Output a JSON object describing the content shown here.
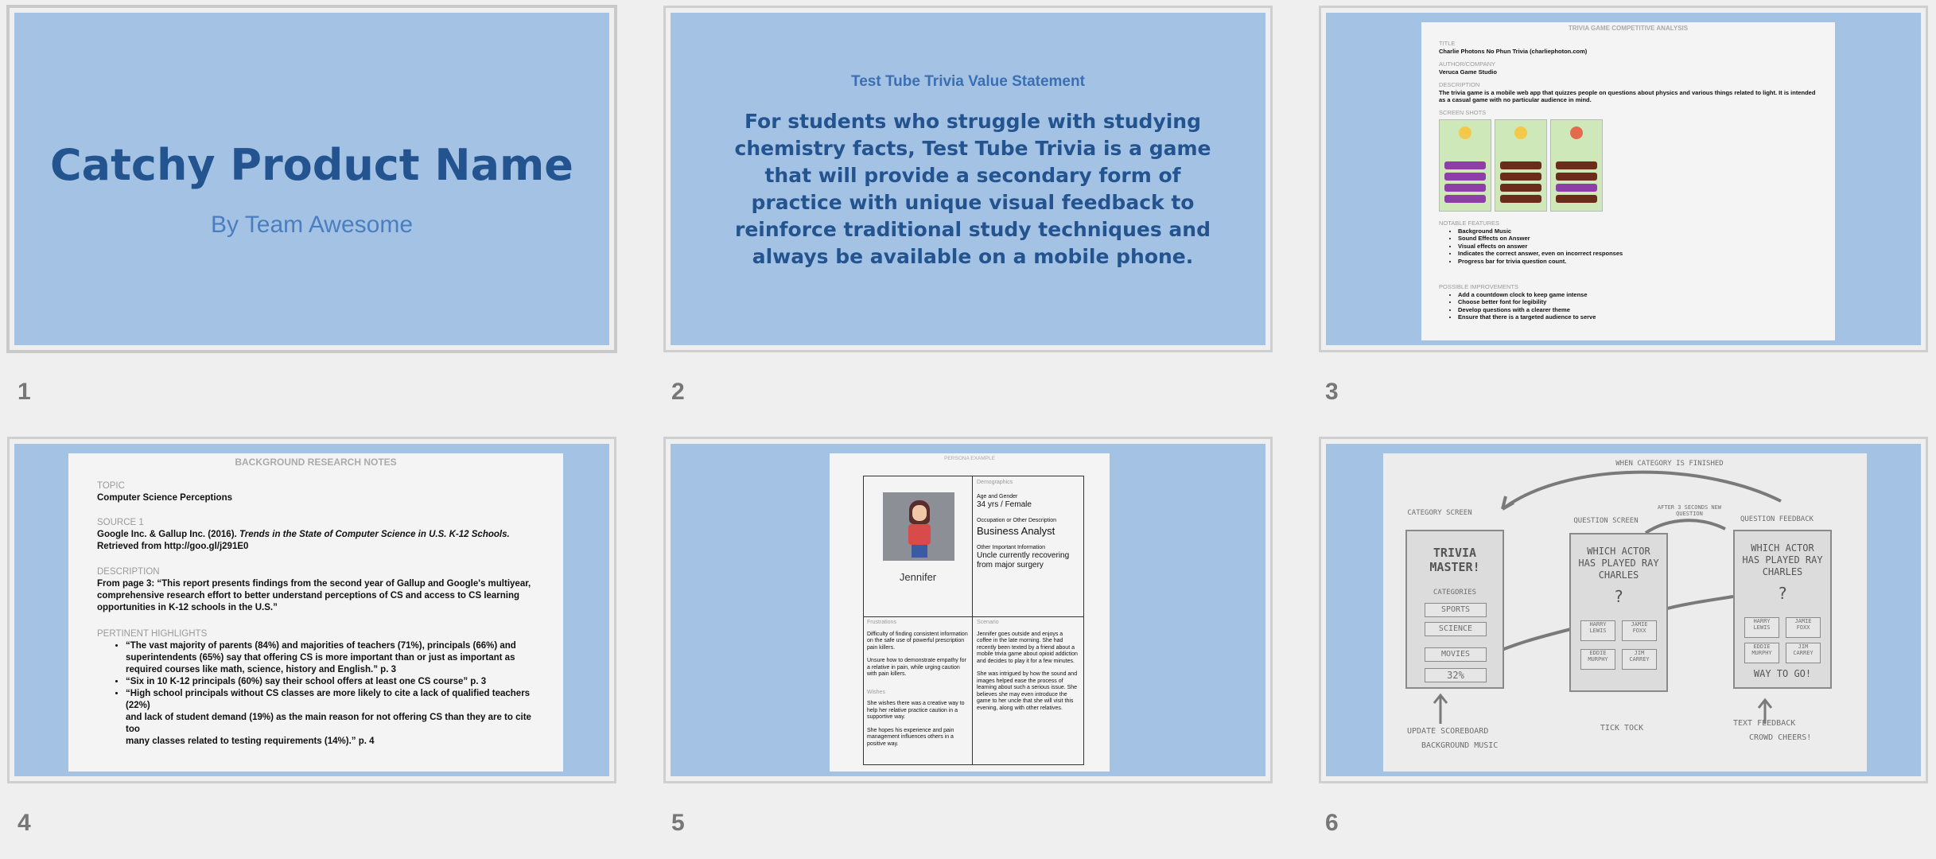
{
  "slides": [
    {
      "number": "1",
      "title": "Catchy Product Name",
      "subtitle": "By Team Awesome"
    },
    {
      "number": "2",
      "title": "Test Tube Trivia Value Statement",
      "body": "For students who struggle with studying chemistry facts, Test Tube Trivia is a game that will provide a secondary form of practice with unique visual feedback to reinforce traditional study techniques and always be available on a mobile phone."
    },
    {
      "number": "3",
      "doc_title": "TRIVIA GAME COMPETITIVE ANALYSIS",
      "title_label": "TITLE",
      "title_value": "Charlie Photons No Phun Trivia (charliephoton.com)",
      "author_label": "AUTHOR/COMPANY",
      "author_value": "Veruca Game Studio",
      "desc_label": "DESCRIPTION",
      "desc_value": "The trivia game is a mobile web app that quizzes people on questions about physics and various things related to light. It is intended as a casual game with no particular audience in mind.",
      "screens_label": "SCREEN SHOTS",
      "features_label": "NOTABLE FEATURES",
      "features": [
        "Background Music",
        "Sound Effects on Answer",
        "Visual effects on answer",
        "Indicates the correct answer, even on incorrect responses",
        "Progress bar for trivia question count."
      ],
      "improvements_label": "POSSIBLE IMPROVEMENTS",
      "improvements": [
        "Add a countdown clock to keep game intense",
        "Choose better font for legibility",
        "Develop questions with a clearer theme",
        "Ensure that there is a targeted audience to serve"
      ]
    },
    {
      "number": "4",
      "doc_title": "BACKGROUND RESEARCH NOTES",
      "topic_label": "TOPIC",
      "topic_value": "Computer Science Perceptions",
      "source_label": "SOURCE 1",
      "source_value_a": "Google Inc. & Gallup Inc. (2016).",
      "source_value_b": "Trends in the State of Computer Science in U.S. K-12 Schools.",
      "source_value_c": "Retrieved from http://goo.gl/j291E0",
      "desc_label": "DESCRIPTION",
      "desc_value": "From page 3: “This report presents findings from the second year of Gallup and Google's multiyear, comprehensive research effort to better understand perceptions of CS and access to CS learning opportunities in K-12 schools in the U.S.”",
      "highlights_label": "PERTINENT HIGHLIGHTS",
      "highlights": [
        "“The vast majority of parents (84%) and majorities of teachers (71%), principals (66%) and superintendents (65%) say that offering CS is more important than or just as important as required courses like math, science, history and English.” p. 3",
        "“Six in 10 K-12 principals (60%) say their school offers at least one CS course” p. 3",
        "“High school principals without CS classes are more likely to cite a lack of qualified teachers (22%)",
        "and lack of student demand (19%) as the main reason for not offering CS than they are to cite too",
        "many classes related to testing requirements (14%).” p. 4"
      ]
    },
    {
      "number": "5",
      "doc_title": "PERSONA EXAMPLE",
      "persona_name": "Jennifer",
      "demo_label": "Demographics",
      "age_label": "Age and Gender",
      "age_value": "34 yrs / Female",
      "occ_label": "Occupation or Other Description",
      "occ_value": "Business Analyst",
      "other_label": "Other Important Information",
      "other_value": "Uncle currently recovering from major surgery",
      "frustrations_label": "Frustrations",
      "frustrations_1": "Difficulty of finding consistent information on the safe use of powerful prescription pain killers.",
      "frustrations_2": "Unsure how to demonstrate empathy for a relative in pain, while urging caution with pain killers.",
      "wishes_label": "Wishes",
      "wishes_1": "She wishes there was a creative way to help her relative practice caution in a supportive way.",
      "wishes_2": "She hopes his experience and pain management influences others in a positive way.",
      "scenario_label": "Scenario",
      "scenario_1": "Jennifer goes outside and enjoys a coffee in the late morning. She had recently been texted by a friend about a mobile trivia game about opioid addiction and decides to play it for a few minutes.",
      "scenario_2": "She was intrigued by how the sound and images helped ease the process of learning about such a serious issue. She believes she may even introduce the game to her uncle that she will visit this evening, along with other relatives."
    },
    {
      "number": "6",
      "sketch": {
        "top_note": "WHEN CATEGORY IS FINISHED",
        "cat_title": "CATEGORY SCREEN",
        "q_title": "QUESTION SCREEN",
        "fb_title": "QUESTION FEEDBACK",
        "mid_note": "AFTER 3 SECONDS NEW QUESTION",
        "trivia": "TRIVIA MASTER!",
        "categories": "CATEGORIES",
        "cat_items": [
          "SPORTS",
          "SCIENCE",
          "MOVIES"
        ],
        "progress": "32%",
        "question": "WHICH ACTOR HAS PLAYED RAY CHARLES",
        "qmark": "?",
        "answers": [
          "HARRY LEWIS",
          "JAMIE FOXX",
          "EDDIE MURPHY",
          "JIM CARREY"
        ],
        "feedback_question": "WHICH ACTOR HAS PLAYED RAY CHARLES",
        "way": "WAY TO GO!",
        "update": "UPDATE SCOREBOARD",
        "bg_music": "BACKGROUND MUSIC",
        "tick": "TICK TOCK",
        "text_fb": "TEXT FEEDBACK",
        "crowd": "CROWD CHEERS!"
      }
    }
  ],
  "colors": {
    "slide_bg": "#a4c3e4",
    "title_blue": "#24548f",
    "sub_blue": "#4a7ec0"
  }
}
